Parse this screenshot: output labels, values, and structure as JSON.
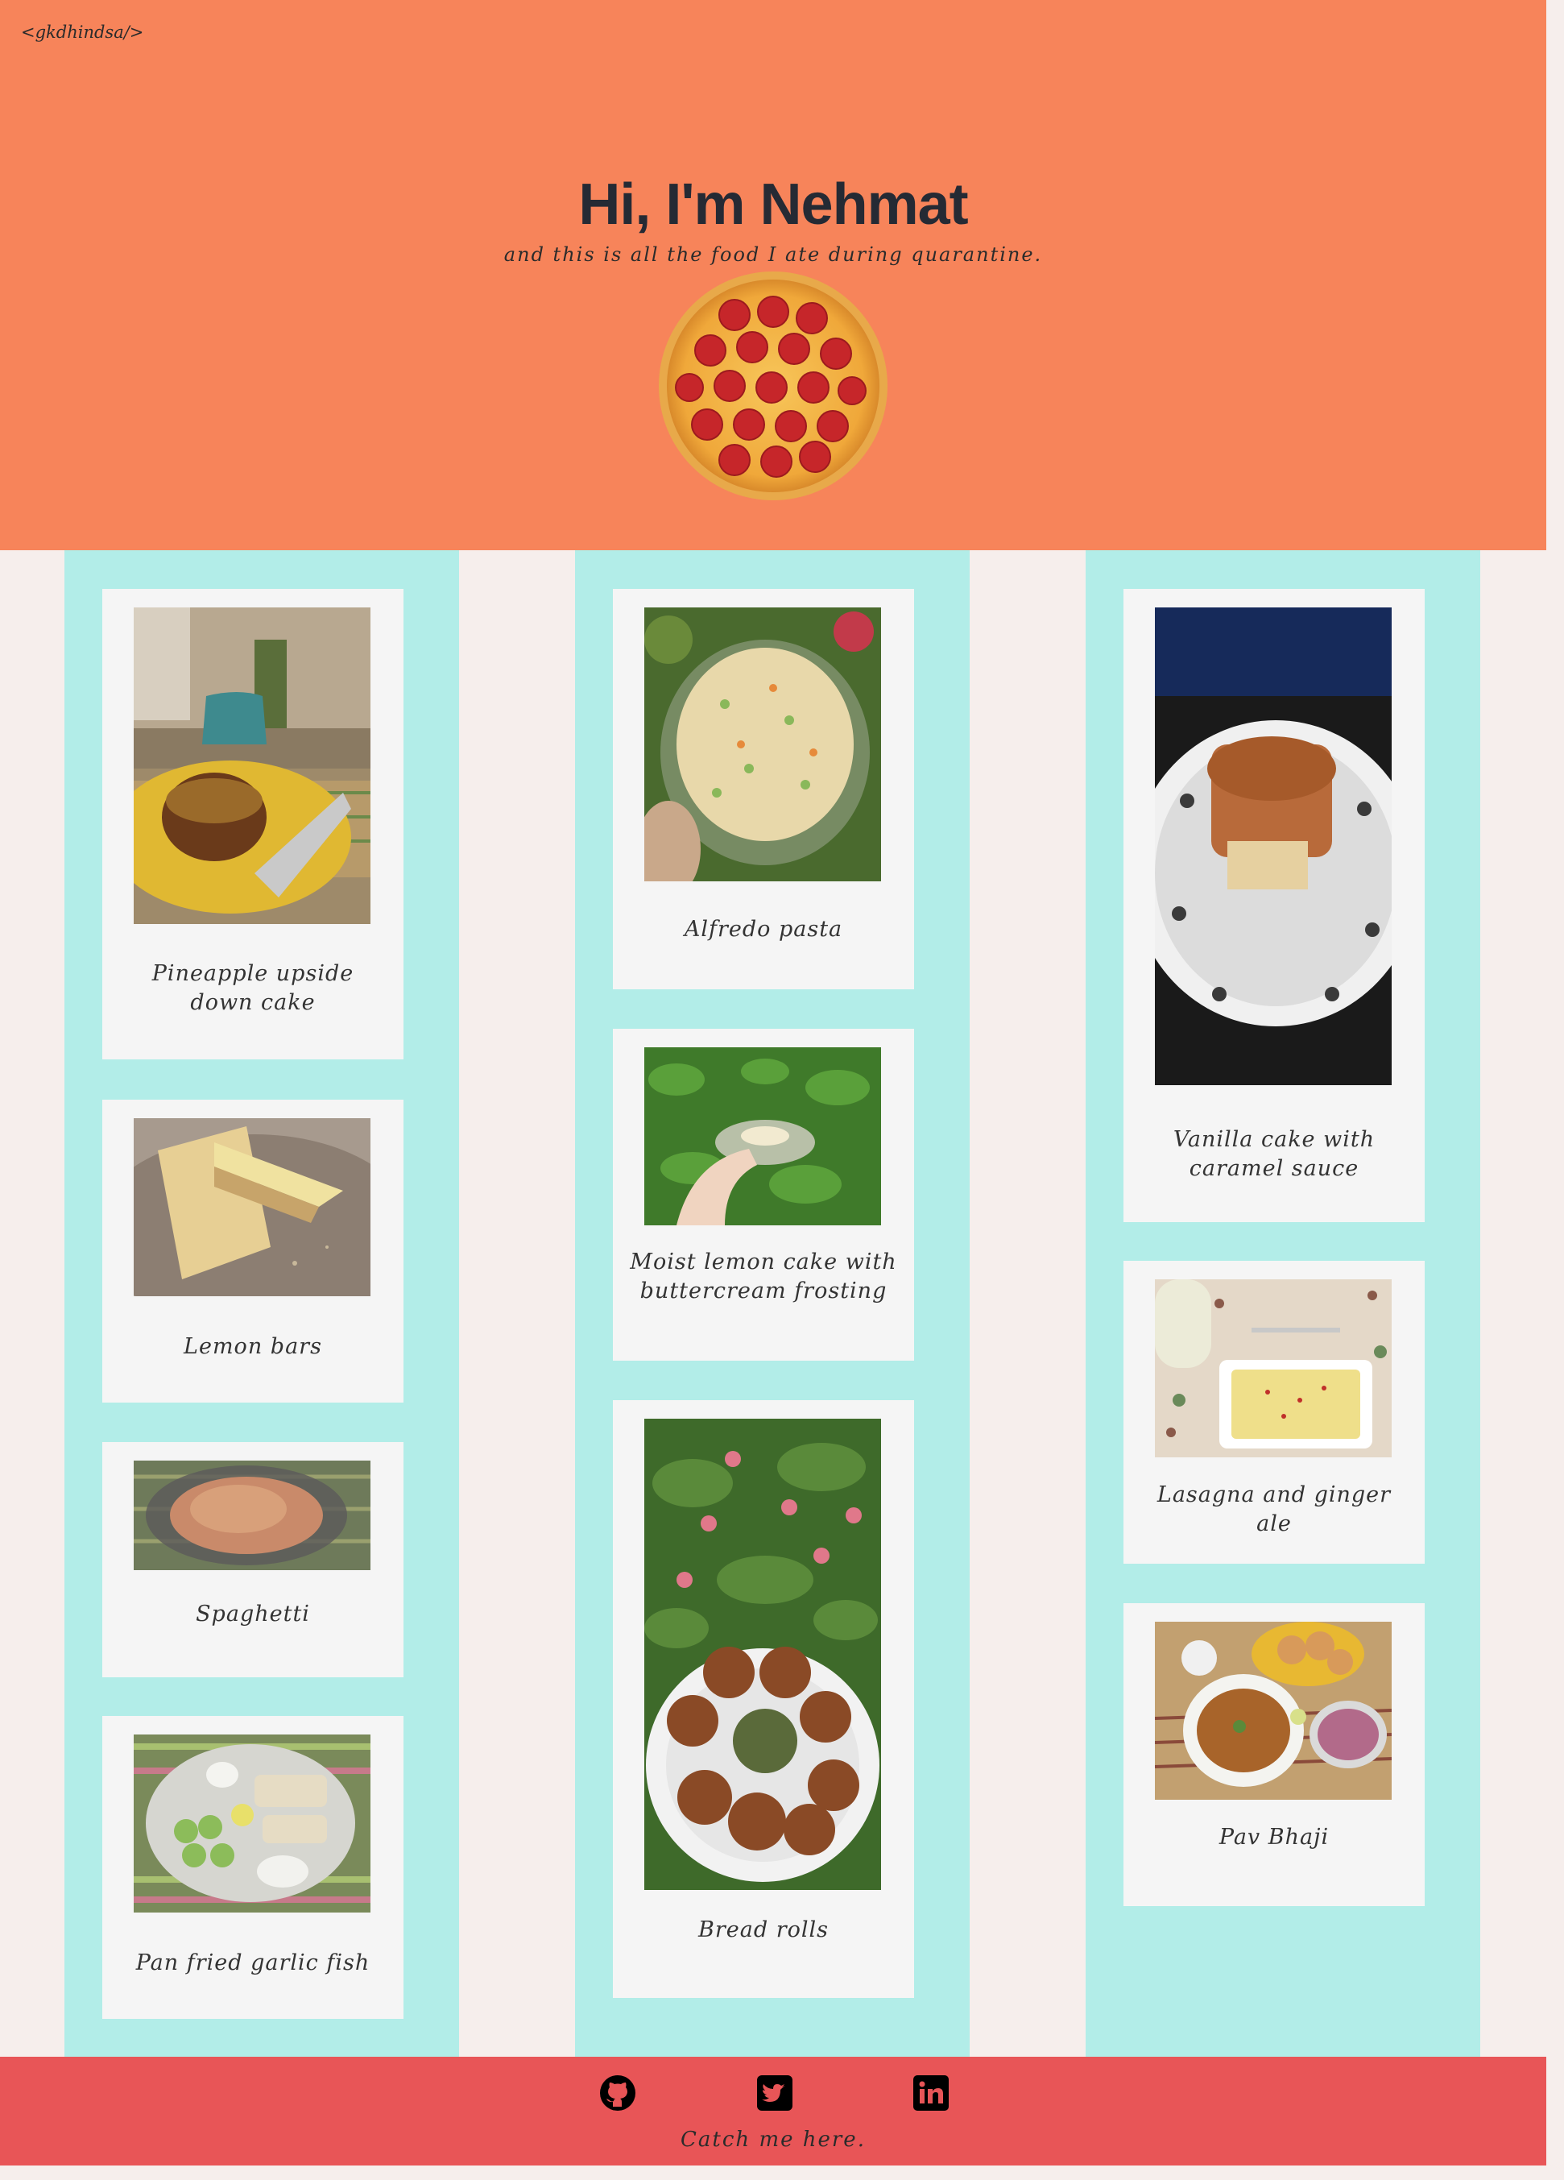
{
  "header": {
    "brand": "<gkdhindsa/>",
    "title": "Hi, I'm Nehmat",
    "subtitle": "and this is all the food I ate during quarantine.",
    "image": "pepperoni-pizza-icon"
  },
  "gallery": {
    "columns": [
      {
        "cards": [
          {
            "caption": "Pineapple upside down cake",
            "image": "pineapple-upside-down-cake-photo"
          },
          {
            "caption": "Lemon bars",
            "image": "lemon-bars-photo"
          },
          {
            "caption": "Spaghetti",
            "image": "spaghetti-photo"
          },
          {
            "caption": "Pan fried garlic fish",
            "image": "pan-fried-garlic-fish-photo"
          }
        ]
      },
      {
        "cards": [
          {
            "caption": "Alfredo pasta",
            "image": "alfredo-pasta-photo"
          },
          {
            "caption": "Moist lemon cake with buttercream frosting",
            "image": "moist-lemon-cake-photo"
          },
          {
            "caption": "Bread rolls",
            "image": "bread-rolls-photo"
          }
        ]
      },
      {
        "cards": [
          {
            "caption": "Vanilla cake with caramel sauce",
            "image": "vanilla-cake-photo"
          },
          {
            "caption": "Lasagna and ginger ale",
            "image": "lasagna-photo"
          },
          {
            "caption": "Pav Bhaji",
            "image": "pav-bhaji-photo"
          }
        ]
      }
    ]
  },
  "footer": {
    "links": [
      {
        "icon": "github-icon"
      },
      {
        "icon": "twitter-icon"
      },
      {
        "icon": "linkedin-icon"
      }
    ],
    "text": "Catch me here."
  },
  "colors": {
    "header_bg": "#f7845a",
    "page_bg": "#f6eeec",
    "column_bg": "#b2ede8",
    "card_bg": "#f5f5f5",
    "footer_bg": "#e85557",
    "title_text": "#252a34"
  }
}
